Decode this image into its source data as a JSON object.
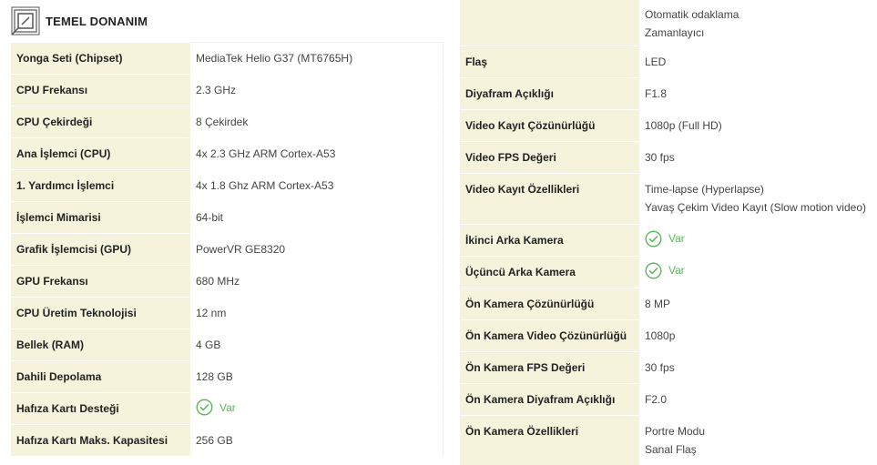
{
  "section": {
    "title": "TEMEL DONANIM",
    "icon": "chip-icon"
  },
  "colors": {
    "label_bg": "#f5f3dc",
    "check_green": "#5cb85c"
  },
  "left_rows": [
    {
      "label": "Yonga Seti (Chipset)",
      "value": "MediaTek Helio G37 (MT6765H)"
    },
    {
      "label": "CPU Frekansı",
      "value": "2.3 GHz"
    },
    {
      "label": "CPU Çekirdeği",
      "value": "8 Çekirdek"
    },
    {
      "label": "Ana İşlemci (CPU)",
      "value": "4x 2.3 GHz ARM Cortex-A53"
    },
    {
      "label": "1. Yardımcı İşlemci",
      "value": "4x 1.8 Ghz ARM Cortex-A53"
    },
    {
      "label": "İşlemci Mimarisi",
      "value": "64-bit"
    },
    {
      "label": "Grafik İşlemcisi (GPU)",
      "value": "PowerVR GE8320"
    },
    {
      "label": "GPU Frekansı",
      "value": "680 MHz"
    },
    {
      "label": "CPU Üretim Teknolojisi",
      "value": "12 nm"
    },
    {
      "label": "Bellek (RAM)",
      "value": "4 GB"
    },
    {
      "label": "Dahili Depolama",
      "value": "128 GB"
    },
    {
      "label": "Hafıza Kartı Desteği",
      "value": "Var"
    },
    {
      "label": "Hafıza Kartı Maks. Kapasitesi",
      "value": "256 GB"
    }
  ],
  "right_top_values": [
    "Otomatik odaklama",
    "Zamanlayıcı"
  ],
  "right_rows": [
    {
      "label": "Flaş",
      "value": "LED"
    },
    {
      "label": "Diyafram Açıklığı",
      "value": "F1.8"
    },
    {
      "label": "Video Kayıt Çözünürlüğü",
      "value": "1080p (Full HD)"
    },
    {
      "label": "Video FPS Değeri",
      "value": "30 fps"
    },
    {
      "label": "Video Kayıt Özellikleri",
      "values": [
        "Time-lapse (Hyperlapse)",
        "Yavaş Çekim Video Kayıt (Slow motion video)"
      ]
    },
    {
      "label": "İkinci Arka Kamera",
      "value": "Var"
    },
    {
      "label": "Üçüncü Arka Kamera",
      "value": "Var"
    },
    {
      "label": "Ön Kamera Çözünürlüğü",
      "value": "8 MP"
    },
    {
      "label": "Ön Kamera Video Çözünürlüğü",
      "value": "1080p"
    },
    {
      "label": "Ön Kamera FPS Değeri",
      "value": "30 fps"
    },
    {
      "label": "Ön Kamera Diyafram Açıklığı",
      "value": "F2.0"
    },
    {
      "label": "Ön Kamera Özellikleri",
      "values": [
        "Portre Modu",
        "Sanal Flaş"
      ]
    }
  ]
}
